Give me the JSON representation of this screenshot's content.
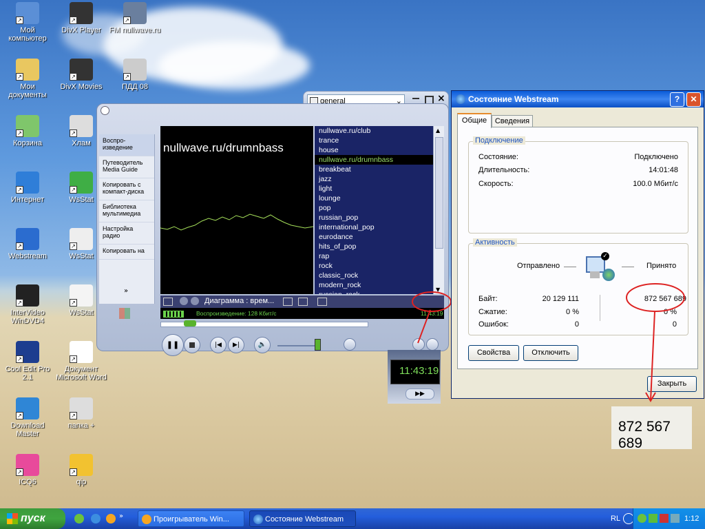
{
  "desktop": {
    "icons": [
      {
        "label": "Мой компьютер",
        "icon": "computer-icon"
      },
      {
        "label": "DivX Player",
        "icon": "divx-icon"
      },
      {
        "label": "FM nullwave.ru",
        "icon": "audio-icon"
      },
      {
        "label": "Мои документы",
        "icon": "folder-icon"
      },
      {
        "label": "DivX Movies",
        "icon": "divx-icon"
      },
      {
        "label": "ПДД 08",
        "icon": "app-icon"
      },
      {
        "label": "Корзина",
        "icon": "recycle-bin-icon"
      },
      {
        "label": "Хлам",
        "icon": "shortcut-icon"
      },
      {
        "label": "Интернет",
        "icon": "ie-icon"
      },
      {
        "label": "WsStat",
        "icon": "wsstat-icon"
      },
      {
        "label": "Webstream",
        "icon": "network-icon"
      },
      {
        "label": "WsStat",
        "icon": "window-icon"
      },
      {
        "label": "InterVideo WinDVD4",
        "icon": "dvd-icon"
      },
      {
        "label": "WsStat",
        "icon": "document-icon"
      },
      {
        "label": "Cool Edit Pro 2.1",
        "icon": "cooledit-icon"
      },
      {
        "label": "Документ Microsoft Word",
        "icon": "word-icon"
      },
      {
        "label": "Download Master",
        "icon": "download-icon"
      },
      {
        "label": "папка +",
        "icon": "shortcut-icon"
      },
      {
        "label": "ICQ6",
        "icon": "icq-icon"
      },
      {
        "label": "qip",
        "icon": "qip-icon"
      }
    ]
  },
  "wmp": {
    "playlist_select": "general",
    "nav": [
      "Воспро-изведение",
      "Путеводитель Media Guide",
      "Копировать с компакт-диска",
      "Библиотека мультимедиа",
      "Настройка радио",
      "Копировать на"
    ],
    "vis_title": "nullwave.ru/drumnbass",
    "playlist": [
      "nullwave.ru/club",
      "trance",
      "house",
      "nullwave.ru/drumnbass",
      "breakbeat",
      "jazz",
      "light",
      "lounge",
      "pop",
      "russian_pop",
      "international_pop",
      "eurodance",
      "hits_of_pop",
      "rap",
      "rock",
      "classic_rock",
      "modern_rock",
      "russian_rock"
    ],
    "selected_index": 3,
    "vis_label": "Диаграмма : врем...",
    "status": "Воспроизведение: 128 Кбит/с",
    "time": "11:43:19",
    "zoom_time": "11:43:19"
  },
  "dialog": {
    "title": "Состояние Webstream",
    "tabs": [
      "Общие",
      "Сведения"
    ],
    "connection": {
      "legend": "Подключение",
      "rows": [
        {
          "label": "Состояние:",
          "value": "Подключено"
        },
        {
          "label": "Длительность:",
          "value": "14:01:48"
        },
        {
          "label": "Скорость:",
          "value": "100.0 Мбит/с"
        }
      ]
    },
    "activity": {
      "legend": "Активность",
      "sent_label": "Отправлено",
      "received_label": "Принято",
      "rows": [
        {
          "label": "Байт:",
          "sent": "20 129 111",
          "received": "872 567 689"
        },
        {
          "label": "Сжатие:",
          "sent": "0 %",
          "received": "0 %"
        },
        {
          "label": "Ошибок:",
          "sent": "0",
          "received": "0"
        }
      ]
    },
    "buttons": {
      "properties": "Свойства",
      "disconnect": "Отключить",
      "close": "Закрыть"
    },
    "zoom_bytes": "872 567 689"
  },
  "taskbar": {
    "start": "пуск",
    "tasks": [
      "Проигрыватель Win...",
      "Состояние Webstream"
    ],
    "lang": "RL",
    "clock": "1:12"
  }
}
